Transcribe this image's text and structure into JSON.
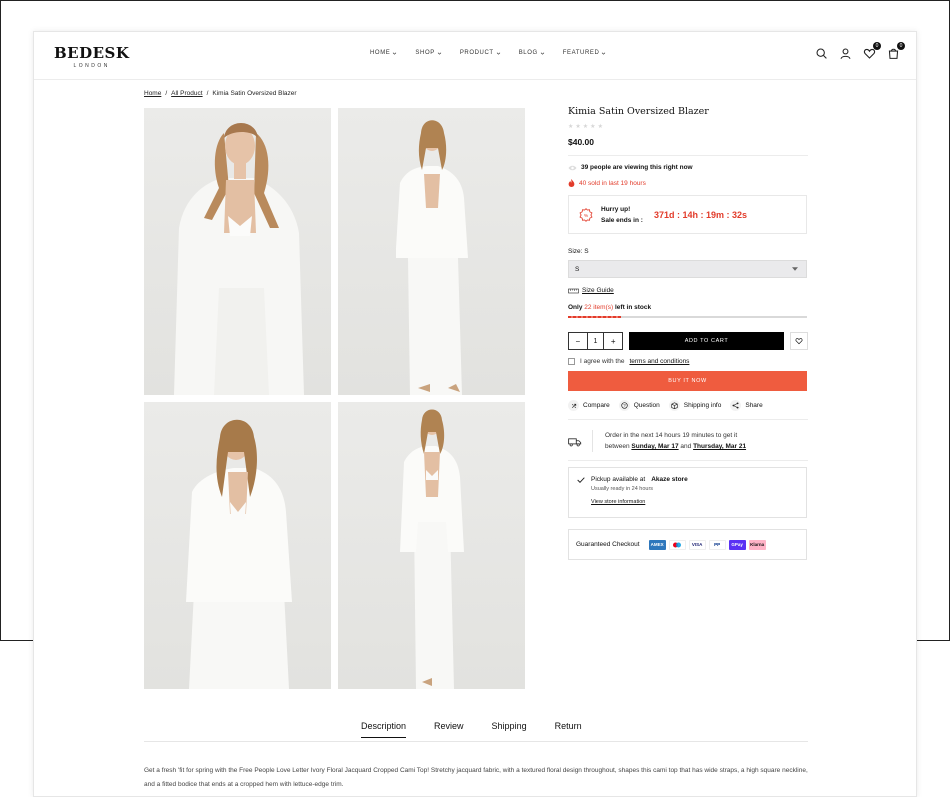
{
  "brand": {
    "name": "BEDESK",
    "sub": "LONDON"
  },
  "nav": [
    {
      "label": "HOME"
    },
    {
      "label": "SHOP"
    },
    {
      "label": "PRODUCT"
    },
    {
      "label": "BLOG"
    },
    {
      "label": "FEATURED"
    }
  ],
  "header": {
    "wishlist_count": "0",
    "cart_count": "0"
  },
  "breadcrumb": {
    "home": "Home",
    "all": "All Product",
    "current": "Kimia Satin Oversized Blazer",
    "sep": "/"
  },
  "product": {
    "title": "Kimia Satin Oversized Blazer",
    "rating": 0,
    "price": "$40.00",
    "viewing": "39 people are viewing this right now",
    "sold": "40 sold in last 19 hours",
    "hurry": "Hurry up!",
    "sale_ends": "Sale ends in :",
    "countdown": "371d : 14h : 19m : 32s",
    "size_label": "Size: S",
    "size_value": "S",
    "size_guide": "Size Guide",
    "stock_prefix": "Only",
    "stock_count": "22 item(s)",
    "stock_suffix": "left in stock",
    "stock_level": 0.22,
    "qty": "1",
    "add_to_cart": "ADD TO CART",
    "agree_text": "I agree with the",
    "terms": "terms and conditions",
    "buy_now": "BUY IT NOW",
    "actions": [
      "Compare",
      "Question",
      "Shipping info",
      "Share"
    ],
    "delivery_line1": "Order in the next 14 hours 19 minutes to get it",
    "delivery_between": "between",
    "delivery_date1": "Sunday, Mar 17",
    "delivery_and": "and",
    "delivery_date2": "Thursday, Mar 21",
    "pickup_prefix": "Pickup available at",
    "pickup_store": "Akaze store",
    "pickup_sub": "Usually ready in 24 hours",
    "pickup_link": "View store information",
    "checkout_label": "Guaranteed Checkout",
    "payments": [
      "AMEX",
      "MC",
      "VISA",
      "PP",
      "GPay",
      "Klarna"
    ]
  },
  "tabs": [
    {
      "label": "Description",
      "active": true
    },
    {
      "label": "Review"
    },
    {
      "label": "Shipping"
    },
    {
      "label": "Return"
    }
  ],
  "description": "Get a fresh 'fit for spring with the Free People Love Letter Ivory Floral Jacquard Cropped Cami Top! Stretchy jacquard fabric, with a textured floral design throughout, shapes this cami top that has wide straps, a high square neckline, and a fitted bodice that ends at a cropped hem with lettuce-edge trim.",
  "colors": {
    "accent": "#ef5c3f",
    "sale": "#e23b2a"
  }
}
